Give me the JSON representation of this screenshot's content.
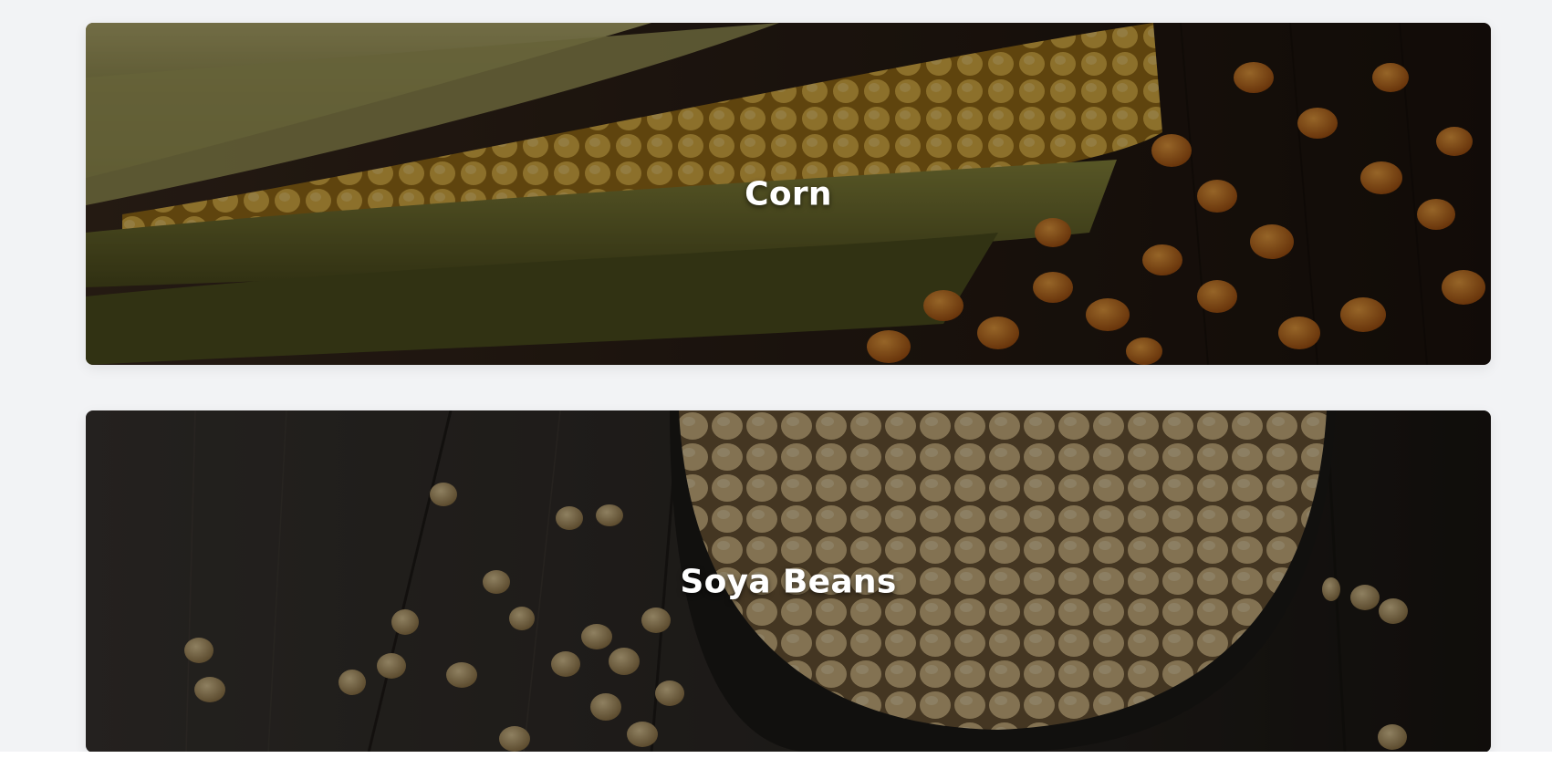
{
  "categories": [
    {
      "id": "corn",
      "title": "Corn",
      "image": "corn-image"
    },
    {
      "id": "soya-beans",
      "title": "Soya Beans",
      "image": "soya-beans-image"
    }
  ]
}
